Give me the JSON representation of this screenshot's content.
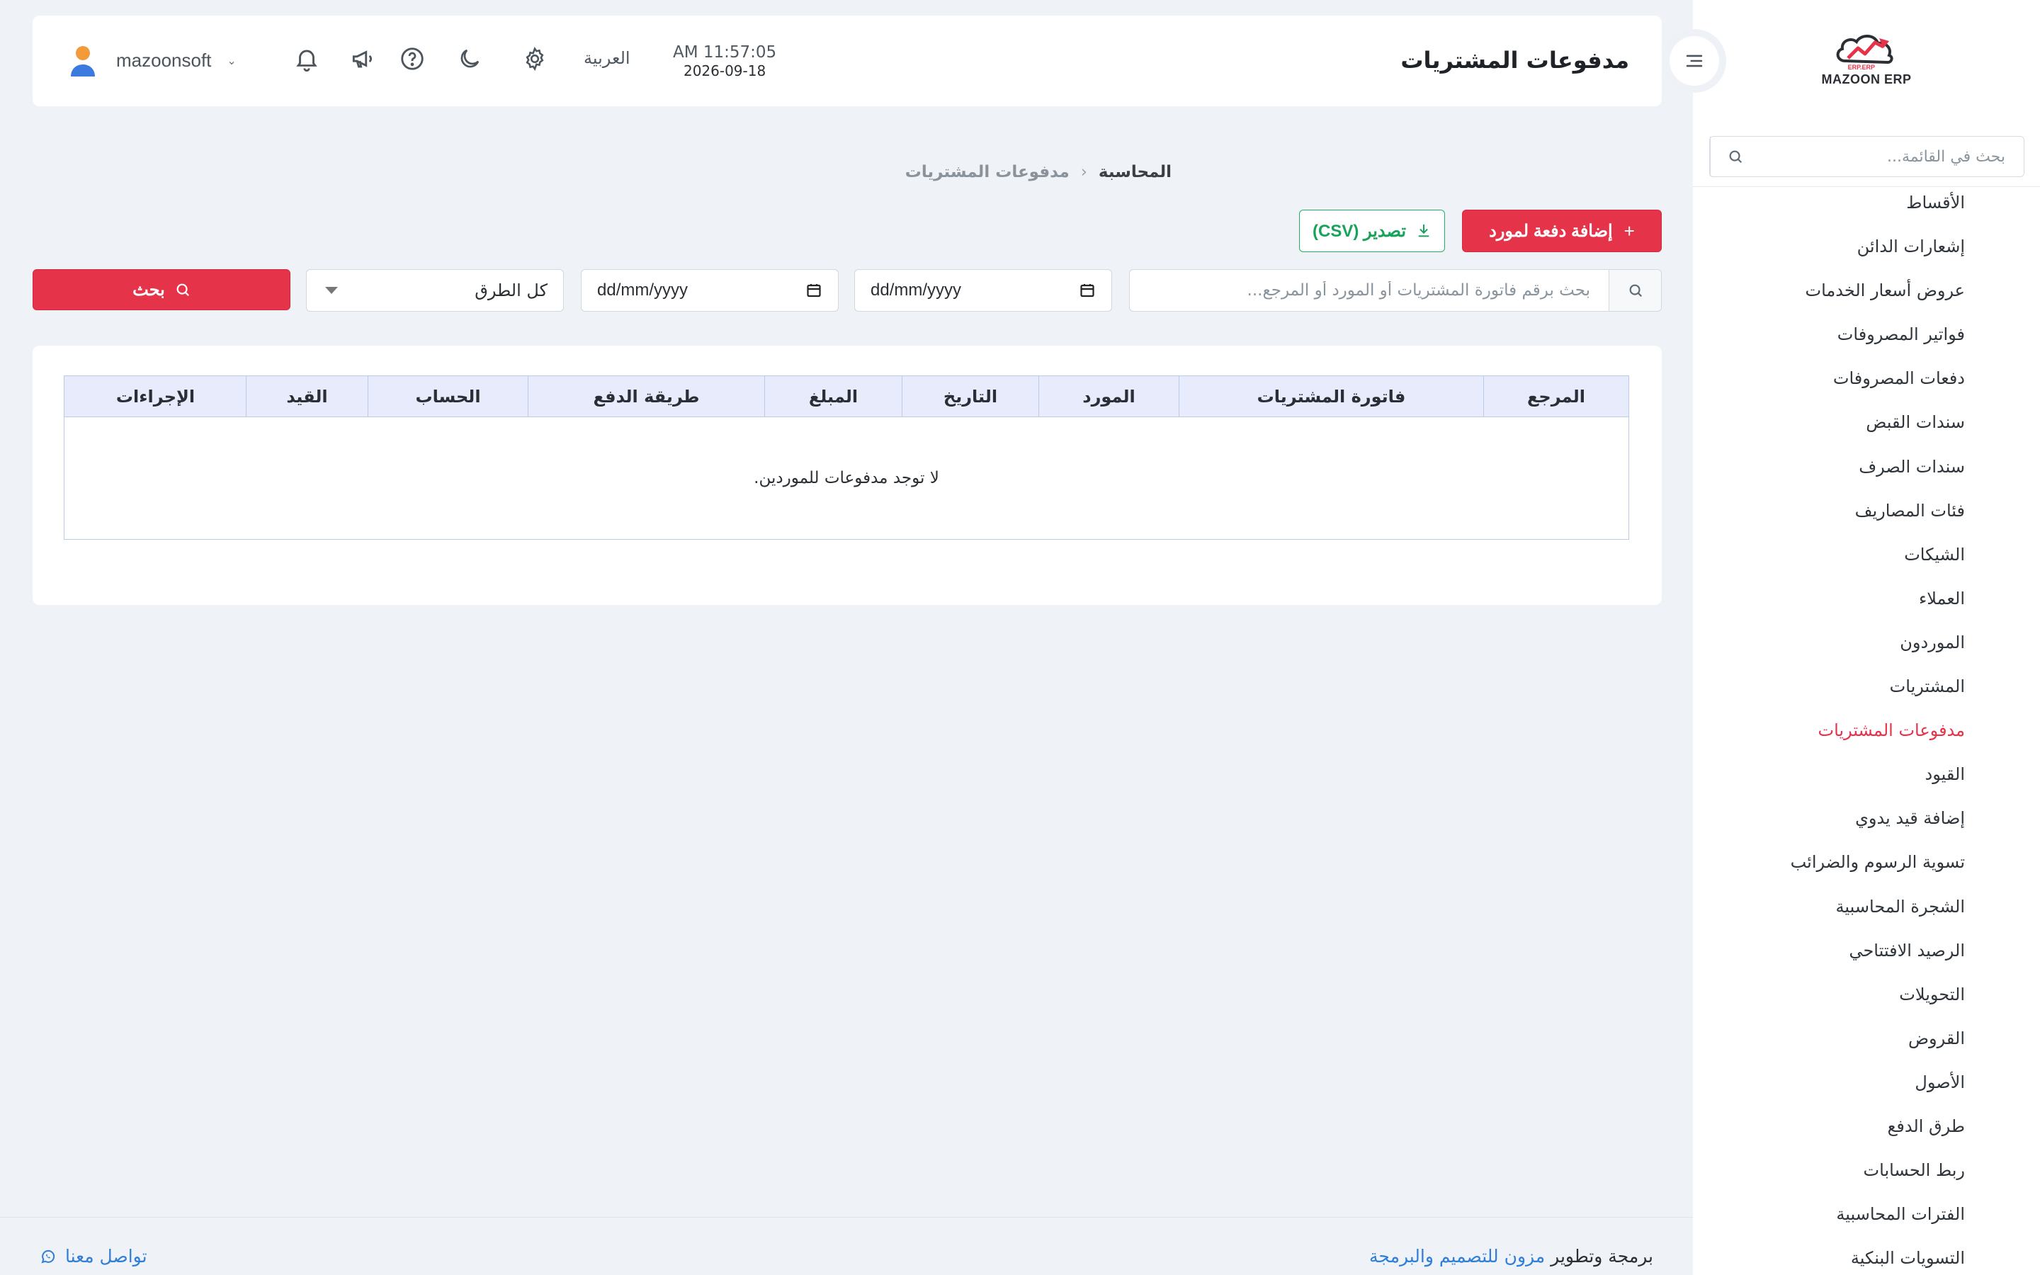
{
  "app": {
    "logo_text": "MAZOON ERP",
    "logo_tag": "ERP.ERP"
  },
  "sidebar": {
    "search_placeholder": "بحث في القائمة...",
    "items": [
      {
        "label": "الأقساط"
      },
      {
        "label": "إشعارات الدائن"
      },
      {
        "label": "عروض أسعار الخدمات"
      },
      {
        "label": "فواتير المصروفات"
      },
      {
        "label": "دفعات المصروفات"
      },
      {
        "label": "سندات القبض"
      },
      {
        "label": "سندات الصرف"
      },
      {
        "label": "فئات المصاريف"
      },
      {
        "label": "الشيكات"
      },
      {
        "label": "العملاء"
      },
      {
        "label": "الموردون"
      },
      {
        "label": "المشتريات"
      },
      {
        "label": "مدفوعات المشتريات",
        "active": true
      },
      {
        "label": "القيود"
      },
      {
        "label": "إضافة قيد يدوي"
      },
      {
        "label": "تسوية الرسوم والضرائب"
      },
      {
        "label": "الشجرة المحاسبية"
      },
      {
        "label": "الرصيد الافتتاحي"
      },
      {
        "label": "التحويلات"
      },
      {
        "label": "القروض"
      },
      {
        "label": "الأصول"
      },
      {
        "label": "طرق الدفع"
      },
      {
        "label": "ربط الحسابات"
      },
      {
        "label": "الفترات المحاسبية"
      },
      {
        "label": "التسويات البنكية"
      }
    ]
  },
  "header": {
    "page_title": "مدفوعات المشتريات",
    "time": "AM 11:57:05",
    "date": "2026-09-18",
    "language": "العربية",
    "username": "mazoonsoft",
    "icons": [
      "settings-icon",
      "moon-icon",
      "help-icon",
      "megaphone-icon",
      "bell-icon"
    ]
  },
  "breadcrumb": {
    "root": "المحاسبة",
    "separator": "‹",
    "current": "مدفوعات المشتريات"
  },
  "actions": {
    "add_label": "إضافة دفعة لمورد",
    "export_label": "تصدير (CSV)"
  },
  "filters": {
    "search_placeholder": "بحث برقم فاتورة المشتريات أو المورد أو المرجع...",
    "date_from": "dd/mm/yyyy",
    "date_to": "dd/mm/yyyy",
    "method_selected": "كل الطرق",
    "search_button": "بحث"
  },
  "table": {
    "columns": [
      {
        "label": "المرجع"
      },
      {
        "label": "فاتورة المشتريات"
      },
      {
        "label": "المورد"
      },
      {
        "label": "التاريخ"
      },
      {
        "label": "المبلغ"
      },
      {
        "label": "طريقة الدفع"
      },
      {
        "label": "الحساب"
      },
      {
        "label": "القيد"
      },
      {
        "label": "الإجراءات"
      }
    ],
    "empty_text": "لا توجد مدفوعات للموردين."
  },
  "footer": {
    "credit_prefix": "برمجة وتطوير",
    "credit_link": "مزون للتصميم والبرمجة",
    "contact": "تواصل معنا"
  },
  "colors": {
    "accent": "#e5344a",
    "export_green": "#20b164",
    "link_blue": "#2f7ed8",
    "table_header_bg": "#e8ebfb",
    "page_bg": "#eff2f6"
  }
}
